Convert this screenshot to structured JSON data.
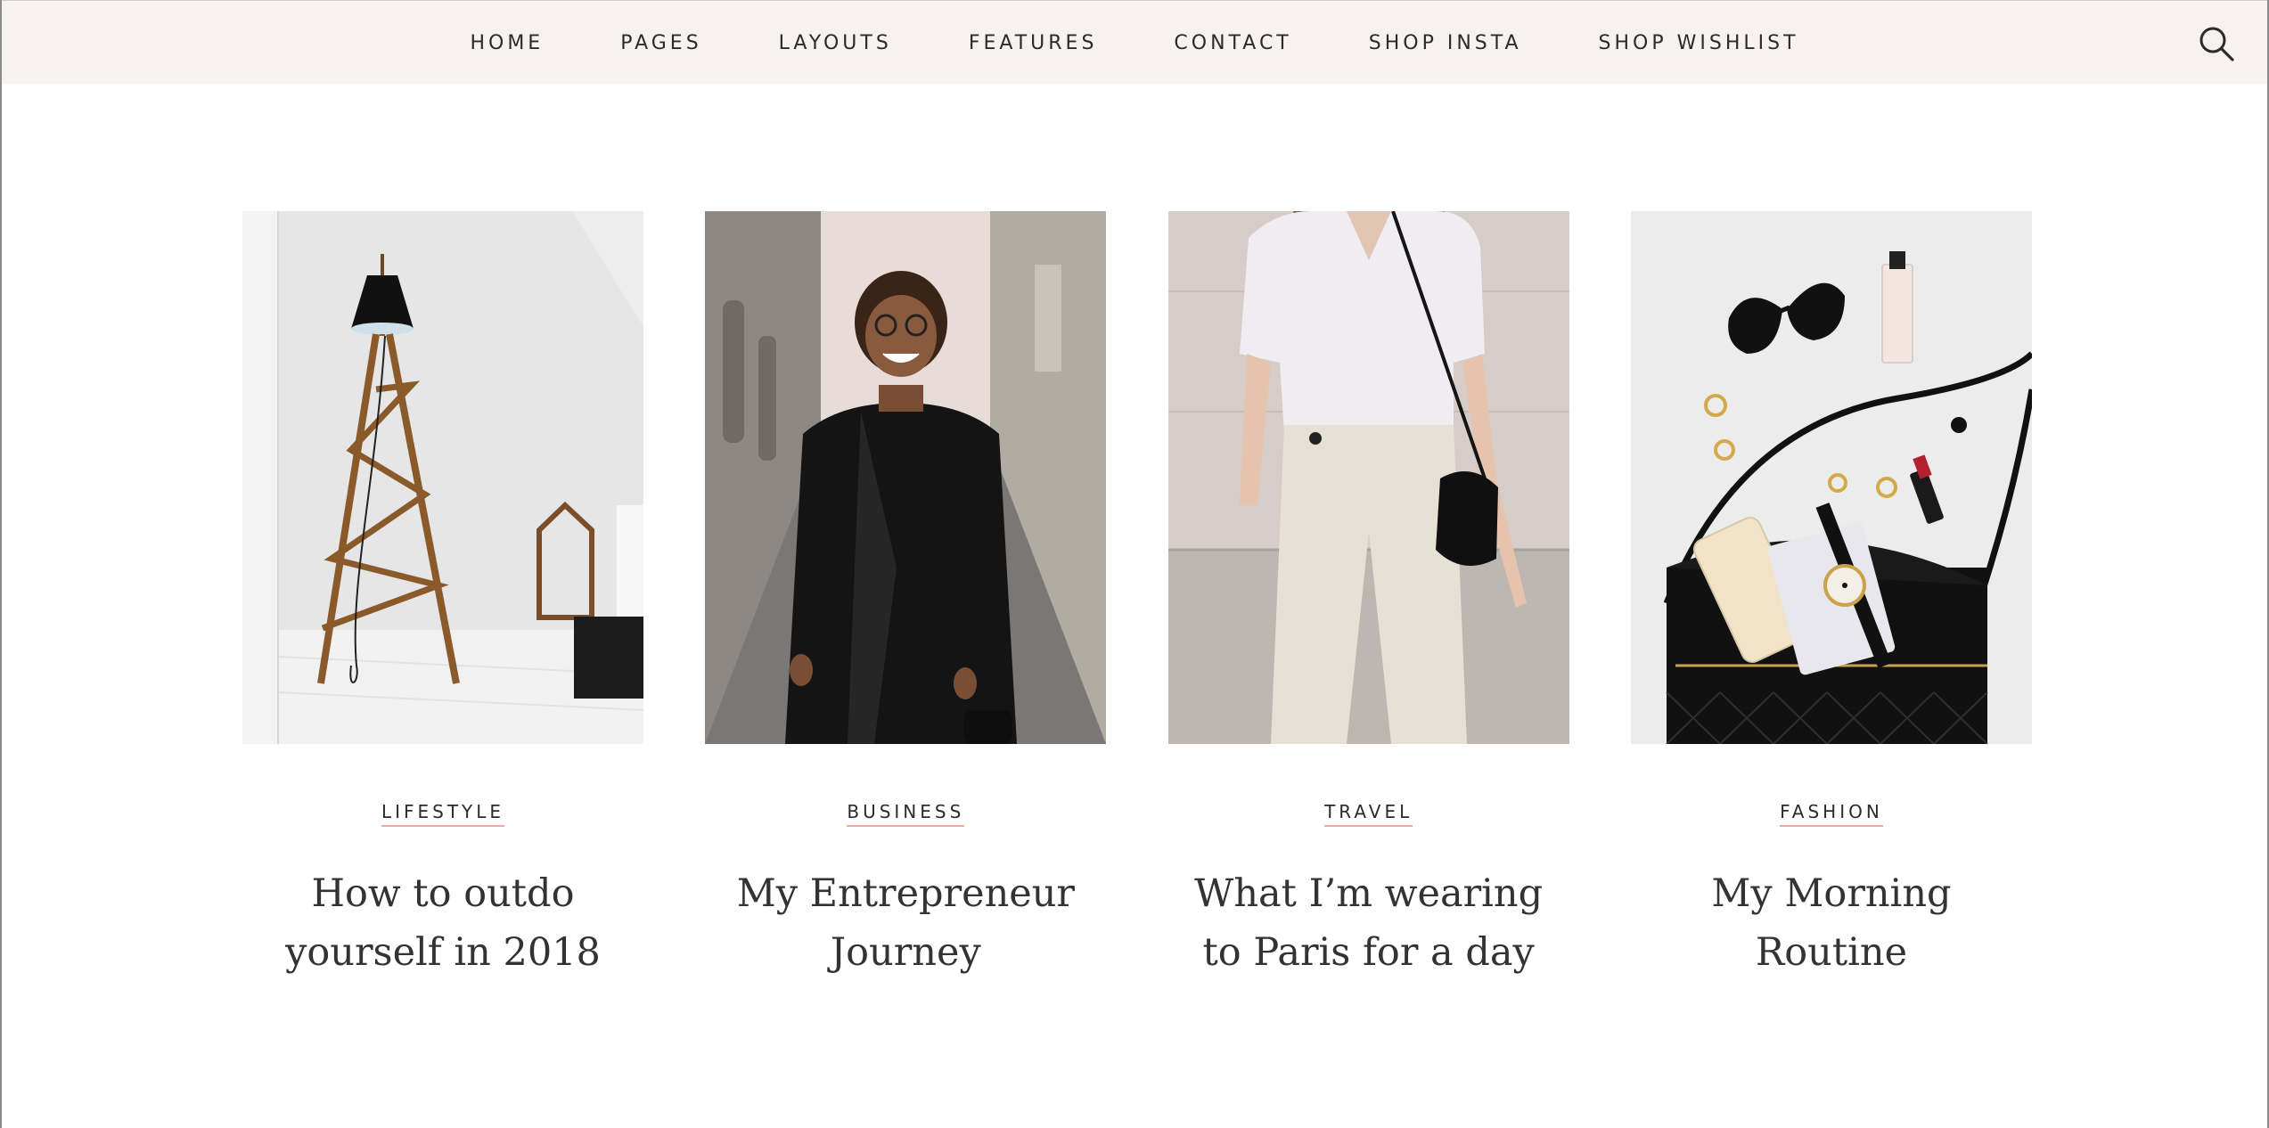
{
  "nav": {
    "items": [
      "HOME",
      "PAGES",
      "LAYOUTS",
      "FEATURES",
      "CONTACT",
      "SHOP INSTA",
      "SHOP WISHLIST"
    ],
    "search_icon": "search-icon"
  },
  "posts": [
    {
      "category": "LIFESTYLE",
      "title": "How to outdo yourself in 2018",
      "image": "floor-lamp-photo"
    },
    {
      "category": "BUSINESS",
      "title": "My Entrepreneur Journey",
      "image": "smiling-woman-street-photo"
    },
    {
      "category": "TRAVEL",
      "title": "What I’m wearing to Paris for a day",
      "image": "white-outfit-photo"
    },
    {
      "category": "FASHION",
      "title": "My Morning Routine",
      "image": "handbag-flatlay-photo"
    }
  ],
  "colors": {
    "header_bg": "#f7f2ef",
    "category_underline": "#f0a8a4",
    "text": "#2b2b2b"
  }
}
